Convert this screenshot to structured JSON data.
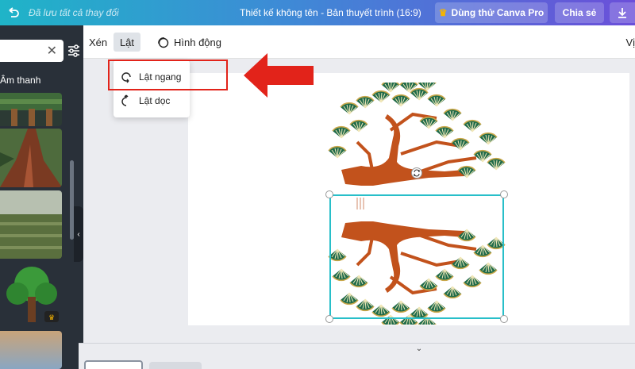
{
  "topbar": {
    "saved_status": "Đã lưu tất cả thay đổi",
    "document_title": "Thiết kế không tên - Bản thuyết trình (16:9)",
    "try_pro_label": "Dùng thử Canva Pro",
    "share_label": "Chia sẻ"
  },
  "left_panel": {
    "tab_label": "Âm thanh"
  },
  "toolbar": {
    "crop_label": "Xén",
    "flip_label": "Lật",
    "animate_label": "Hình động",
    "position_label": "Vị"
  },
  "flip_menu": {
    "items": [
      {
        "label": "Lật ngang"
      },
      {
        "label": "Lật dọc"
      }
    ]
  },
  "colors": {
    "accent": "#28bfc9",
    "highlight": "#e2231a",
    "gradient_start": "#1fb4c8",
    "gradient_end": "#6b4fd9"
  }
}
